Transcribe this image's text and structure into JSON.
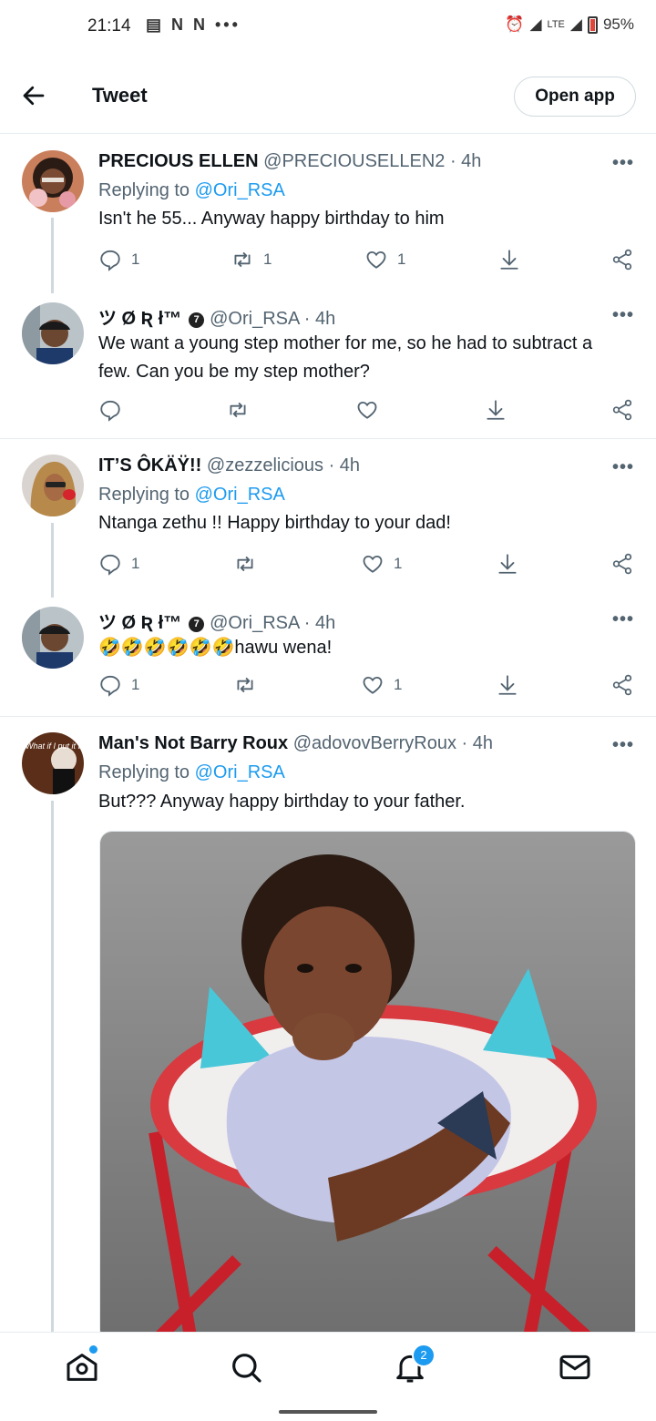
{
  "status_bar": {
    "time": "21:14",
    "notif_icons": "▤ N N •••",
    "network": "LTE",
    "battery": "95%"
  },
  "header": {
    "title": "Tweet",
    "open_app": "Open app"
  },
  "tweets": [
    {
      "name": "PRECIOUS ELLEN",
      "handle": "@PRECIOUSELLEN2",
      "time": "· 4h",
      "replying_prefix": "Replying to",
      "replying_to": "@Ori_RSA",
      "text": "Isn't he 55... Anyway happy birthday to him",
      "replies": "1",
      "retweets": "1",
      "likes": "1"
    },
    {
      "name": "ツ Ø Ʀ ł™",
      "handle": "@Ori_RSA",
      "time": "· 4h",
      "text": "We want a young step mother for me, so he had to subtract a few. Can you be my step mother?",
      "replies": "",
      "retweets": "",
      "likes": ""
    },
    {
      "name": "IT’S ÔKÄŸ!!",
      "handle": "@zezzelicious",
      "time": "· 4h",
      "replying_prefix": "Replying to",
      "replying_to": "@Ori_RSA",
      "text": "Ntanga zethu !! Happy birthday to your dad!",
      "replies": "1",
      "retweets": "",
      "likes": "1"
    },
    {
      "name": "ツ Ø Ʀ ł™",
      "handle": "@Ori_RSA",
      "time": "· 4h",
      "text": "🤣🤣🤣🤣🤣🤣hawu wena!",
      "replies": "1",
      "retweets": "",
      "likes": "1"
    },
    {
      "name": "Man's Not Barry Roux",
      "handle": "@adovovBerryRoux",
      "time": "· 4h",
      "replying_prefix": "Replying to",
      "replying_to": "@Ori_RSA",
      "text": "But??? Anyway happy birthday to your father."
    }
  ],
  "avatar_texts": {
    "barry": "What if I put it to you...?"
  },
  "more_label": "•••",
  "verified_badge": "7",
  "bottom_nav": {
    "notifications_count": "2"
  },
  "colors": {
    "accent": "#1d9bf0",
    "text": "#0f1419",
    "secondary": "#536471",
    "divider": "#e6ecf0"
  }
}
